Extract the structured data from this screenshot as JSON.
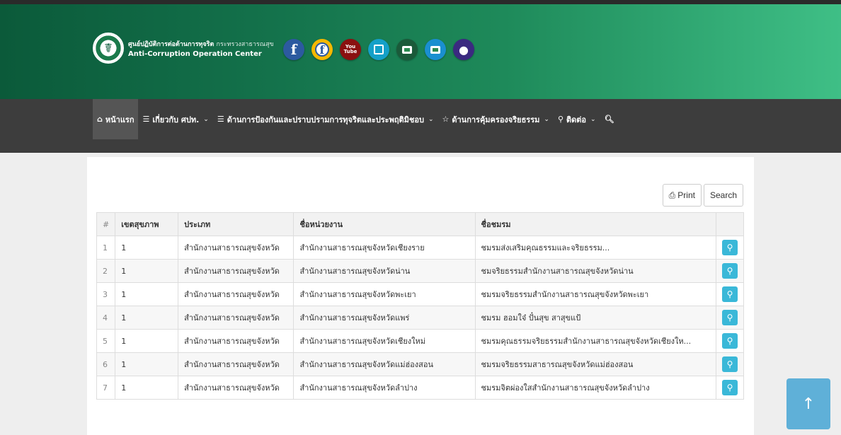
{
  "header": {
    "org_name_th": "ศูนย์ปฏิบัติการต่อต้านการทุจริต",
    "ministry_th": "กระทรวงสาธารณสุข",
    "org_name_en": "Anti-Corruption Operation Center",
    "logo_icon": "ministry-seal",
    "accent": "#1e8a5a"
  },
  "social": [
    {
      "name": "facebook",
      "glyph": "f"
    },
    {
      "name": "facebook-alt",
      "glyph": "f"
    },
    {
      "name": "youtube",
      "glyph_top": "You",
      "glyph_bottom": "Tube"
    },
    {
      "name": "document"
    },
    {
      "name": "gallery"
    },
    {
      "name": "wallet"
    },
    {
      "name": "user-group"
    }
  ],
  "nav": {
    "home": "หน้าแรก",
    "about": "เกี่ยวกับ ศปท.",
    "prevention": "ด้านการป้องกันและปราบปรามการทุจริตและประพฤติมิชอบ",
    "ethics": "ด้านการคุ้มครองจริยธรรม",
    "contact": "ติดต่อ"
  },
  "actions": {
    "print": "Print",
    "search": "Search"
  },
  "table": {
    "headers": [
      "#",
      "เขตสุขภาพ",
      "ประเภท",
      "ชื่อหน่วยงาน",
      "ชื่อชมรม",
      ""
    ],
    "rows": [
      [
        "1",
        "1",
        "สำนักงานสาธารณสุขจังหวัด",
        "สำนักงานสาธารณสุขจังหวัดเชียงราย",
        "ชมรมส่งเสริมคุณธรรมและจริยธรรม..."
      ],
      [
        "2",
        "1",
        "สำนักงานสาธารณสุขจังหวัด",
        "สำนักงานสาธารณสุขจังหวัดน่าน",
        "ชมจริยธรรมสำนักงานสาธารณสุขจังหวัดน่าน"
      ],
      [
        "3",
        "1",
        "สำนักงานสาธารณสุขจังหวัด",
        "สำนักงานสาธารณสุขจังหวัดพะเยา",
        "ชมรมจริยธรรมสำนักงานสาธารณสุขจังหวัดพะเยา"
      ],
      [
        "4",
        "1",
        "สำนักงานสาธารณสุขจังหวัด",
        "สำนักงานสาธารณสุขจังหวัดแพร่",
        "ชมรม ฮอมใจ๋ ปั๋นสุข สาสุขแป้"
      ],
      [
        "5",
        "1",
        "สำนักงานสาธารณสุขจังหวัด",
        "สำนักงานสาธารณสุขจังหวัดเชียงใหม่",
        "ชมรมคุณธรรมจริยธรรมสำนักงานสาธารณสุขจังหวัดเชียงให..."
      ],
      [
        "6",
        "1",
        "สำนักงานสาธารณสุขจังหวัด",
        "สำนักงานสาธารณสุขจังหวัดแม่ฮ่องสอน",
        "ชมรมจริยธรรมสาธารณสุขจังหวัดแม่ฮ่องสอน"
      ],
      [
        "7",
        "1",
        "สำนักงานสาธารณสุขจังหวัด",
        "สำนักงานสาธารณสุขจังหวัดลำปาง",
        "ชมรมจิตผ่องใสสำนักงานสาธารณสุขจังหวัดลำปาง"
      ]
    ]
  },
  "back_to_top": "↑"
}
